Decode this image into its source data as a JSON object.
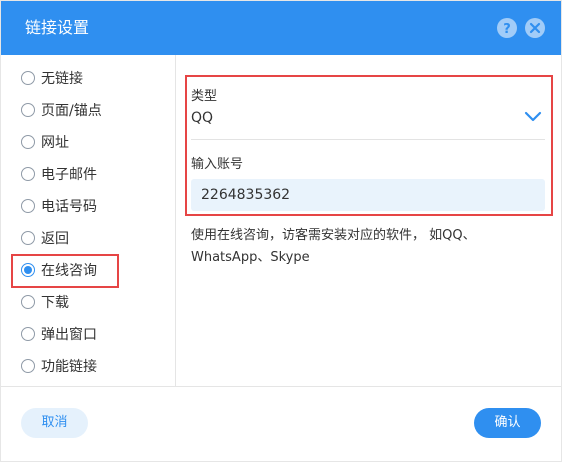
{
  "dialog": {
    "title": "链接设置",
    "help_icon": "question-icon",
    "close_icon": "close-icon"
  },
  "link_types": [
    {
      "label": "无链接",
      "selected": false
    },
    {
      "label": "页面/锚点",
      "selected": false
    },
    {
      "label": "网址",
      "selected": false
    },
    {
      "label": "电子邮件",
      "selected": false
    },
    {
      "label": "电话号码",
      "selected": false
    },
    {
      "label": "返回",
      "selected": false
    },
    {
      "label": "在线咨询",
      "selected": true
    },
    {
      "label": "下载",
      "selected": false
    },
    {
      "label": "弹出窗口",
      "selected": false
    },
    {
      "label": "功能链接",
      "selected": false
    }
  ],
  "settings": {
    "type_label": "类型",
    "type_value": "QQ",
    "account_label": "输入账号",
    "account_value": "2264835362",
    "hint_line1": "使用在线咨询，访客需安装对应的软件， 如QQ、",
    "hint_line2": "WhatsApp、Skype"
  },
  "footer": {
    "cancel_label": "取消",
    "confirm_label": "确认"
  },
  "colors": {
    "accent": "#2f8ff0",
    "highlight": "#e64545"
  }
}
